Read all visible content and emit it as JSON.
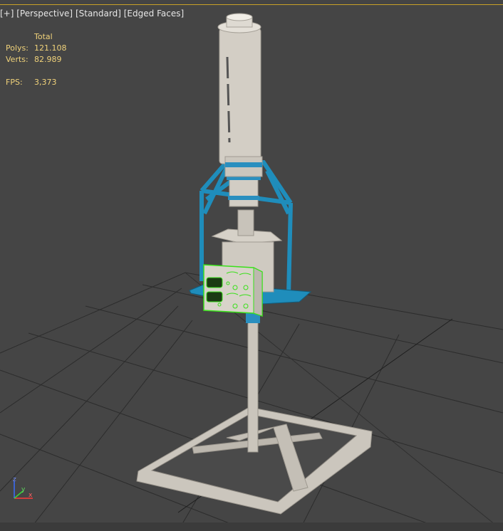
{
  "viewport": {
    "labels": [
      "[+]",
      "[Perspective]",
      "[Standard]",
      "[Edged Faces]"
    ]
  },
  "stats": {
    "header": "Total",
    "polys_label": "Polys:",
    "polys_value": "121.108",
    "verts_label": "Verts:",
    "verts_value": "82.989",
    "fps_label": "FPS:",
    "fps_value": "3,373"
  },
  "gizmo": {
    "axis_z": "z",
    "axis_x": "x",
    "axis_y": "y"
  },
  "colors": {
    "selection": "#39e01a",
    "frame_blue": "#1e8fb8",
    "model_grey": "#cfcac2",
    "grid": "#2b2b2b",
    "label_text": "#e6e6e6",
    "stats_text": "#f0d27a"
  }
}
